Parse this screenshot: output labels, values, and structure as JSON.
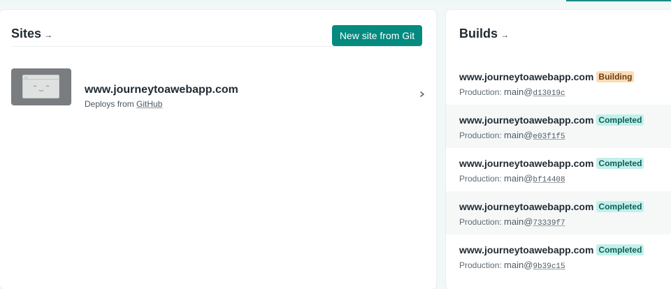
{
  "sites": {
    "title": "Sites",
    "title_arrow": "→",
    "new_site_button": "New site from Git",
    "items": [
      {
        "name": "www.journeytoawebapp.com",
        "deploys_prefix": "Deploys from",
        "deploys_provider": "GitHub",
        "thumbnail_icon": "site-screenshot-placeholder-icon",
        "chevron_icon": "chevron-right-icon"
      }
    ]
  },
  "builds": {
    "title": "Builds",
    "title_arrow": "→",
    "items": [
      {
        "site": "www.journeytoawebapp.com",
        "status": "Building",
        "context": "Production:",
        "branch": "main@",
        "sha": "d13019c"
      },
      {
        "site": "www.journeytoawebapp.com",
        "status": "Completed",
        "context": "Production:",
        "branch": "main@",
        "sha": "e03f1f5"
      },
      {
        "site": "www.journeytoawebapp.com",
        "status": "Completed",
        "context": "Production:",
        "branch": "main@",
        "sha": "bf14408"
      },
      {
        "site": "www.journeytoawebapp.com",
        "status": "Completed",
        "context": "Production:",
        "branch": "main@",
        "sha": "73339f7"
      },
      {
        "site": "www.journeytoawebapp.com",
        "status": "Completed",
        "context": "Production:",
        "branch": "main@",
        "sha": "9b39c15"
      }
    ]
  },
  "colors": {
    "accent": "#048a7f",
    "badge_building_bg": "#fbdcb4",
    "badge_completed_bg": "#c2f0ea",
    "page_bg": "#f2f8f8"
  }
}
